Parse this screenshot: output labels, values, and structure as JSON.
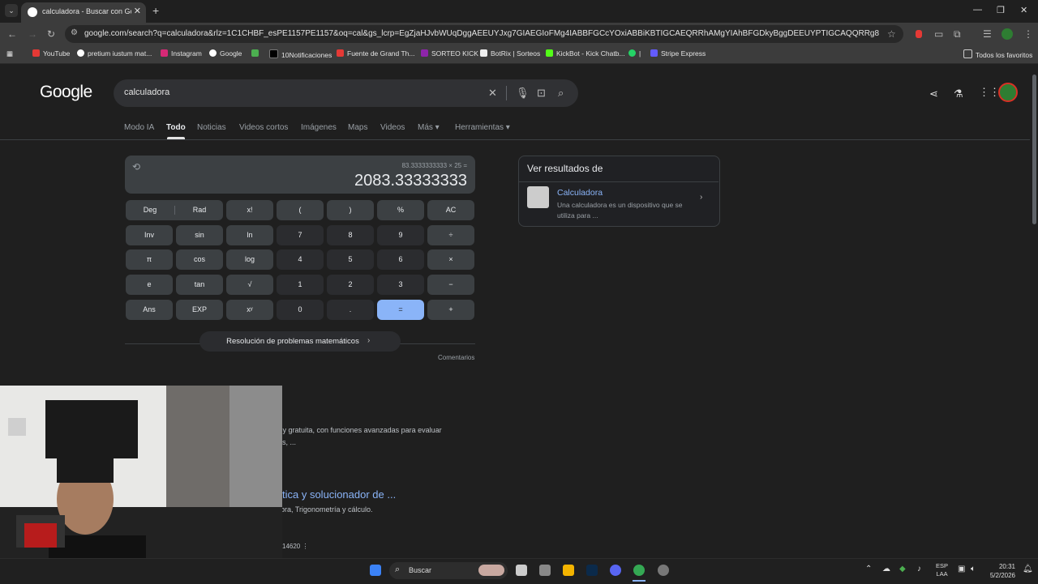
{
  "browser": {
    "tab_title": "calculadora - Buscar con Googl",
    "url": "google.com/search?q=calculadora&rlz=1C1CHBF_esPE1157PE1157&oq=cal&gs_lcrp=EgZjaHJvbWUqDggAEEUYJxg7GIAEGIoFMg4IABBFGCcYOxiABBiKBTIGCAEQRRhAMgYIAhBFGDkyBggDEEUYPTIGCAQQRRg8MgYIBRBFGD0yBggGEEUY...",
    "bookmarks": [
      "YouTube",
      "pretium iustum mat...",
      "Instagram",
      "Google",
      "10Notificaciones",
      "Fuente de Grand Th...",
      "SORTEO KICK",
      "BotRix | Sorteos",
      "KickBot - Kick Chatb...",
      "|",
      "Stripe Express"
    ],
    "bookmarks_all": "Todos los favoritos"
  },
  "google": {
    "logo": "Google",
    "query": "calculadora",
    "tabs": [
      "Modo IA",
      "Todo",
      "Noticias",
      "Videos cortos",
      "Imágenes",
      "Maps",
      "Videos",
      "Más ▾",
      "Herramientas ▾"
    ],
    "active_tab": "Todo"
  },
  "calculator": {
    "expression": "83.3333333333 × 25 =",
    "result": "2083.33333333",
    "deg": "Deg",
    "rad": "Rad",
    "keys": [
      [
        "x!",
        "(",
        ")",
        "%",
        "AC"
      ],
      [
        "Inv",
        "sin",
        "ln",
        "7",
        "8",
        "9",
        "÷"
      ],
      [
        "π",
        "cos",
        "log",
        "4",
        "5",
        "6",
        "×"
      ],
      [
        "e",
        "tan",
        "√",
        "1",
        "2",
        "3",
        "−"
      ],
      [
        "Ans",
        "EXP",
        "xʸ",
        "0",
        ".",
        "=",
        "+"
      ]
    ],
    "solver": "Resolución de problemas matemáticos",
    "feedback": "Comentarios"
  },
  "side_card": {
    "title": "Ver resultados de",
    "name": "Calculadora",
    "desc": "Una calculadora es un dispositivo que se utiliza para ..."
  },
  "results": {
    "snippet1a": "a y gratuita, con funciones avanzadas para evaluar",
    "snippet1b": "les, ...",
    "link2": "tica y solucionador de ...",
    "snippet2": "ebra, Trigonometría y cálculo.",
    "meta": "14620  ⋮"
  },
  "taskbar": {
    "search": "Buscar",
    "lang1": "ESP",
    "lang2": "LAA",
    "time": "20:31",
    "date": "5/2/2026"
  }
}
